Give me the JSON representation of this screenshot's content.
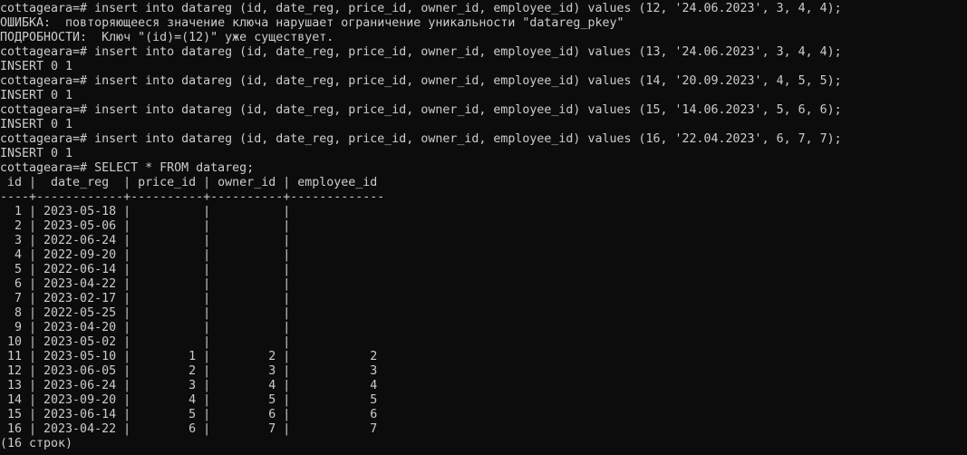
{
  "terminal": {
    "lines": [
      "cottageara=# insert into datareg (id, date_reg, price_id, owner_id, employee_id) values (12, '24.06.2023', 3, 4, 4);",
      "ОШИБКА:  повторяющееся значение ключа нарушает ограничение уникальности \"datareg_pkey\"",
      "ПОДРОБНОСТИ:  Ключ \"(id)=(12)\" уже существует.",
      "cottageara=# insert into datareg (id, date_reg, price_id, owner_id, employee_id) values (13, '24.06.2023', 3, 4, 4);",
      "INSERT 0 1",
      "cottageara=# insert into datareg (id, date_reg, price_id, owner_id, employee_id) values (14, '20.09.2023', 4, 5, 5);",
      "INSERT 0 1",
      "cottageara=# insert into datareg (id, date_reg, price_id, owner_id, employee_id) values (15, '14.06.2023', 5, 6, 6);",
      "INSERT 0 1",
      "cottageara=# insert into datareg (id, date_reg, price_id, owner_id, employee_id) values (16, '22.04.2023', 6, 7, 7);",
      "INSERT 0 1",
      "cottageara=# SELECT * FROM datareg;",
      " id |  date_reg  | price_id | owner_id | employee_id",
      "----+------------+----------+----------+-------------",
      "  1 | 2023-05-18 |          |          |",
      "  2 | 2023-05-06 |          |          |",
      "  3 | 2022-06-24 |          |          |",
      "  4 | 2022-09-20 |          |          |",
      "  5 | 2022-06-14 |          |          |",
      "  6 | 2023-04-22 |          |          |",
      "  7 | 2023-02-17 |          |          |",
      "  8 | 2022-05-25 |          |          |",
      "  9 | 2023-04-20 |          |          |",
      " 10 | 2023-05-02 |          |          |",
      " 11 | 2023-05-10 |        1 |        2 |           2",
      " 12 | 2023-06-05 |        2 |        3 |           3",
      " 13 | 2023-06-24 |        3 |        4 |           4",
      " 14 | 2023-09-20 |        4 |        5 |           5",
      " 15 | 2023-06-14 |        5 |        6 |           6",
      " 16 | 2023-04-22 |        6 |        7 |           7",
      "(16 строк)"
    ]
  }
}
